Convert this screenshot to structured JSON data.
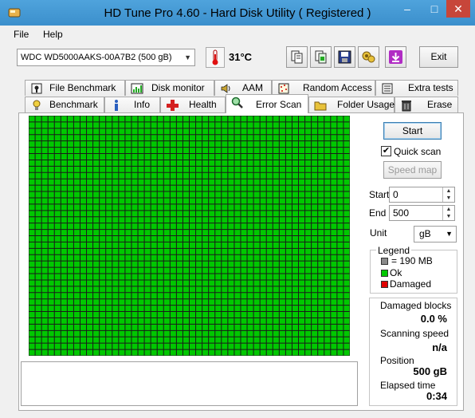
{
  "window": {
    "title": "HD Tune Pro 4.60 - Hard Disk Utility (  Registered )",
    "minimize": "–",
    "maximize": "□",
    "close": "✕"
  },
  "menu": [
    {
      "label": "File"
    },
    {
      "label": "Help"
    }
  ],
  "toolbar": {
    "drive": "WDC WD5000AAKS-00A7B2 (500 gB)",
    "temperature": "31°C",
    "exit_label": "Exit",
    "icons": [
      "copy-text-icon",
      "copy-screenshot-icon",
      "save-icon",
      "options-icon",
      "download-icon"
    ]
  },
  "tabs_top": [
    {
      "label": "File Benchmark",
      "icon": "file-benchmark-icon"
    },
    {
      "label": "Disk monitor",
      "icon": "disk-monitor-icon"
    },
    {
      "label": "AAM",
      "icon": "speaker-icon"
    },
    {
      "label": "Random Access",
      "icon": "random-access-icon"
    },
    {
      "label": "Extra tests",
      "icon": "extra-tests-icon"
    }
  ],
  "tabs_bottom": [
    {
      "label": "Benchmark",
      "icon": "benchmark-icon"
    },
    {
      "label": "Info",
      "icon": "info-icon"
    },
    {
      "label": "Health",
      "icon": "health-icon"
    },
    {
      "label": "Error Scan",
      "icon": "magnifier-icon",
      "active": true
    },
    {
      "label": "Folder Usage",
      "icon": "folder-icon"
    },
    {
      "label": "Erase",
      "icon": "trash-icon"
    }
  ],
  "scan": {
    "columns": 50,
    "rows": 38,
    "ok_color": "#00c800",
    "damaged_color": "#e00000",
    "grid_line_color": "#1a1a1a"
  },
  "controls": {
    "start_label": "Start",
    "quick_scan_label": "Quick scan",
    "quick_scan_checked": true,
    "speed_map_label": "Speed map",
    "start_field_label": "Start",
    "start_value": "0",
    "end_field_label": "End",
    "end_value": "500",
    "unit_label": "Unit",
    "unit_value": "gB"
  },
  "legend": {
    "title": "Legend",
    "block_size": "= 190 MB",
    "ok": "Ok",
    "damaged": "Damaged"
  },
  "stats": {
    "damaged_blocks_label": "Damaged blocks",
    "damaged_blocks_value": "0.0 %",
    "scanning_speed_label": "Scanning speed",
    "scanning_speed_value": "n/a",
    "position_label": "Position",
    "position_value": "500 gB",
    "elapsed_label": "Elapsed time",
    "elapsed_value": "0:34"
  }
}
